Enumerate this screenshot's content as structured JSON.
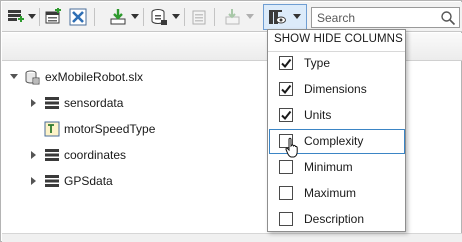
{
  "toolbar": {
    "search_placeholder": "Search",
    "buttons": [
      {
        "name": "add-row-icon"
      },
      {
        "name": "add-bus-icon"
      },
      {
        "name": "delete-icon"
      },
      {
        "name": "import-icon"
      },
      {
        "name": "save-dictionary-icon"
      },
      {
        "name": "export-icon"
      },
      {
        "name": "move-icon"
      },
      {
        "name": "show-hide-columns-icon"
      },
      {
        "name": "search-icon"
      }
    ]
  },
  "tree": {
    "items": [
      {
        "label": "exMobileRobot.slx",
        "icon": "model-file-icon",
        "expanded": true,
        "level": 0
      },
      {
        "label": "sensordata",
        "icon": "bus-icon",
        "expanded": false,
        "level": 1
      },
      {
        "label": "motorSpeedType",
        "icon": "type-icon",
        "expanded": null,
        "level": 1
      },
      {
        "label": "coordinates",
        "icon": "bus-icon",
        "expanded": false,
        "level": 1
      },
      {
        "label": "GPSdata",
        "icon": "bus-icon",
        "expanded": false,
        "level": 1
      }
    ]
  },
  "menu": {
    "title": "SHOW HIDE COLUMNS",
    "items": [
      {
        "label": "Type",
        "checked": true
      },
      {
        "label": "Dimensions",
        "checked": true
      },
      {
        "label": "Units",
        "checked": true
      },
      {
        "label": "Complexity",
        "checked": false,
        "hovered": true
      },
      {
        "label": "Minimum",
        "checked": false
      },
      {
        "label": "Maximum",
        "checked": false
      },
      {
        "label": "Description",
        "checked": false
      }
    ]
  },
  "colors": {
    "accent": "#3b85c5",
    "active_button_bg": "#dcebfa",
    "toolbar_bg": "#f2f2f2"
  }
}
